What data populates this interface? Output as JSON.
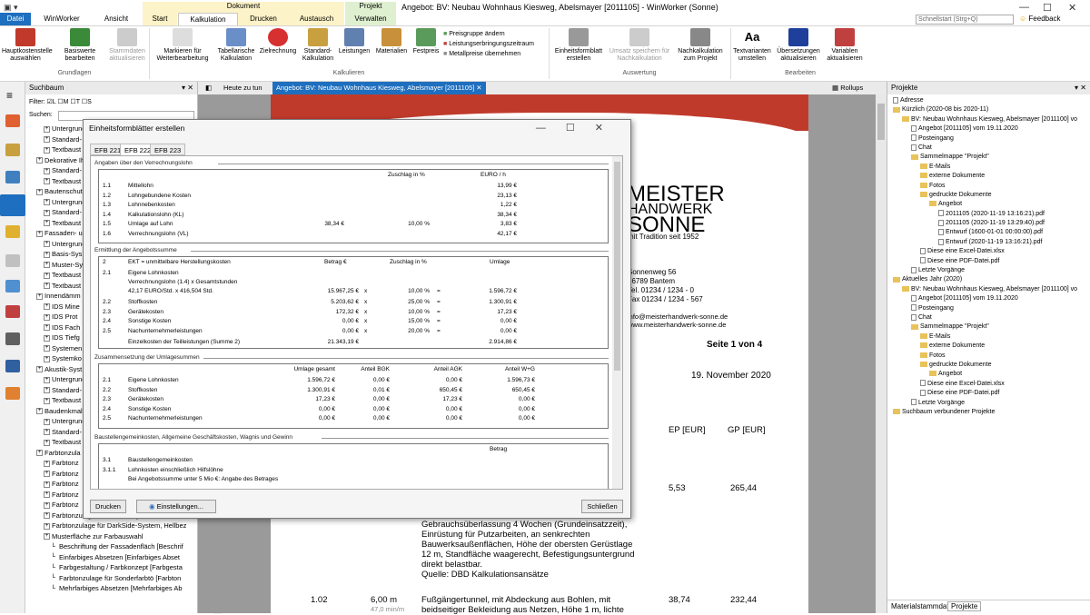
{
  "window": {
    "title": "Angebot: BV: Neubau Wohnhaus Kiesweg, Abelsmayer [2011105] - WinWorker (Sonne)",
    "context_group_dokument": "Dokument",
    "context_group_projekt": "Projekt",
    "search_placeholder": "Schnellstart (Strg+Q)",
    "feedback": "Feedback",
    "minimize": "—",
    "maximize": "☐",
    "close": "✕"
  },
  "tabs": [
    "Datei",
    "WinWorker",
    "Ansicht",
    "Start",
    "Kalkulation",
    "Drucken",
    "Austausch",
    "Verwalten"
  ],
  "ribbon": {
    "buttons": [
      {
        "label": "Hauptkostenstelle auswählen",
        "color": "#c0392b"
      },
      {
        "label": "Basiswerte bearbeiten",
        "color": "#3a8a3a"
      },
      {
        "label": "Stammdaten aktualisieren",
        "color": "#aaaaaa"
      },
      {
        "label": "Markieren für Weiterbearbeitung",
        "color": "#bbbbbb"
      },
      {
        "label": "Tabellarische Kalkulation",
        "color": "#6a8fc8"
      },
      {
        "label": "Zielrechnung",
        "color": "#d63030"
      },
      {
        "label": "Standard-Kalkulation",
        "color": "#c8a040"
      },
      {
        "label": "Leistungen",
        "color": "#6080b0"
      },
      {
        "label": "Materialien",
        "color": "#c8903a"
      },
      {
        "label": "Festpreis",
        "color": "#5a9a5a"
      },
      {
        "label": "Einheitsformblatt erstellen",
        "color": "#666666"
      },
      {
        "label": "Umsatz speichern für Nachkalkulation",
        "color": "#aaaaaa"
      },
      {
        "label": "Nachkalkulation zum Projekt",
        "color": "#777777"
      },
      {
        "label": "Textvarianten umstellen",
        "color": "#333333"
      },
      {
        "label": "Übersetzungen aktualisieren",
        "color": "#1e3f9a"
      },
      {
        "label": "Variablen aktualisieren",
        "color": "#c04040"
      }
    ],
    "small": [
      "Preisgruppe ändern",
      "Leistungserbringungszeitraum",
      "Metallpreise übernehmen"
    ],
    "groups": [
      "Grundlagen",
      "Kalkulieren",
      "Auswertung",
      "Bearbeiten"
    ]
  },
  "suchbaum": {
    "title": "Suchbaum",
    "filter_label": "Filter:",
    "filters": [
      "L",
      "M",
      "T",
      "S"
    ],
    "search_label": "Suchen:",
    "items": [
      {
        "t": "Untergrund",
        "d": 2
      },
      {
        "t": "Standard-",
        "d": 2
      },
      {
        "t": "Textbaust",
        "d": 2
      },
      {
        "t": "Dekorative Ih",
        "d": 1
      },
      {
        "t": "Standard-",
        "d": 2
      },
      {
        "t": "Textbaust",
        "d": 2
      },
      {
        "t": "Bautenschutz",
        "d": 1
      },
      {
        "t": "Untergrund",
        "d": 2
      },
      {
        "t": "Standard-",
        "d": 2
      },
      {
        "t": "Textbaust",
        "d": 2
      },
      {
        "t": "Fassaden- u",
        "d": 1
      },
      {
        "t": "Untergrund",
        "d": 2
      },
      {
        "t": "Basis-Sys",
        "d": 2
      },
      {
        "t": "Muster-Sy",
        "d": 2
      },
      {
        "t": "Textbaust",
        "d": 2
      },
      {
        "t": "Textbaust",
        "d": 2
      },
      {
        "t": "Innendämm",
        "d": 1
      },
      {
        "t": "IDS Mine",
        "d": 2
      },
      {
        "t": "IDS Prot",
        "d": 2
      },
      {
        "t": "IDS Fach",
        "d": 2
      },
      {
        "t": "IDS Tiefg",
        "d": 2
      },
      {
        "t": "Systemen",
        "d": 2
      },
      {
        "t": "Systemko",
        "d": 2
      },
      {
        "t": "Akustik-Syst",
        "d": 1
      },
      {
        "t": "Untergrund",
        "d": 2
      },
      {
        "t": "Standard-",
        "d": 2
      },
      {
        "t": "Textbaust",
        "d": 2
      },
      {
        "t": "Baudenkmal",
        "d": 1
      },
      {
        "t": "Untergrund",
        "d": 2
      },
      {
        "t": "Standard-",
        "d": 2
      },
      {
        "t": "Textbaust",
        "d": 2
      },
      {
        "t": "Farbtonzula",
        "d": 1
      },
      {
        "t": "Farbtonz",
        "d": 2
      },
      {
        "t": "Farbtonz",
        "d": 2
      },
      {
        "t": "Farbtonz",
        "d": 2
      },
      {
        "t": "Farbtonz",
        "d": 2
      },
      {
        "t": "Farbtonz",
        "d": 2
      },
      {
        "t": "Farbtonzulage für Carbon-System, Hellbez",
        "d": 2
      },
      {
        "t": "Farbtonzulage für DarkSide-System, Hellbez",
        "d": 2
      },
      {
        "t": "Musterfläche zur Farbauswahl",
        "d": 2
      },
      {
        "t": "Beschriftung der Fassadenfläch [Beschrif",
        "d": 3
      },
      {
        "t": "Einfarbiges Absetzen [Einfarbiges Abset",
        "d": 3
      },
      {
        "t": "Farbgestaltung / Farbkonzept [Farbgesta",
        "d": 3
      },
      {
        "t": "Farbtonzulage für Sonderfarbtö [Farbton",
        "d": 3
      },
      {
        "t": "Mehrfarbiges Absetzen [Mehrfarbiges Ab",
        "d": 3
      }
    ]
  },
  "doctabs": [
    "Heute zu tun",
    "Angebot: BV: Neubau Wohnhaus Kiesweg, Abelsmayer [2011105]"
  ],
  "rollups": "Rollups",
  "document": {
    "company1": "MEISTER",
    "company2": "HANDWERK",
    "company3": "SONNE",
    "tagline": "mit Tradition seit 1952",
    "addr": [
      "Sonnenweg 56",
      "56789 Bantem",
      "Tel. 01234 / 1234 - 0",
      "Fax 01234 / 1234 - 567"
    ],
    "web": [
      "info@meisterhandwerk-sonne.de",
      "www.meisterhandwerk-sonne.de"
    ],
    "page": "Seite 1 von 4",
    "date": "19. November 2020",
    "col_ep": "EP [EUR]",
    "col_gp": "GP [EUR]",
    "row1_ep": "5,53",
    "row1_gp": "265,44",
    "text1": [
      "Gebrauchsüberlassung 4 Wochen (Grundeinsatzzeit),",
      "Einrüstung für Putzarbeiten, an senkrechten",
      "Bauwerksaußenflächen, Höhe der obersten Gerüstlage",
      "12 m, Standfläche waagerecht, Befestigungsuntergrund",
      "direkt belastbar.",
      "Quelle: DBD Kalkulationsansätze"
    ],
    "row2_pos": "1.02",
    "row2_qty": "6,00 m",
    "row2_sub": "47,0 min/m",
    "row2_ep": "38,74",
    "row2_gp": "232,44",
    "text2": [
      "Fußgängertunnel, mit Abdeckung aus Bohlen, mit",
      "beidseitiger Bekleidung aus Netzen, Höhe 1 m, lichte"
    ]
  },
  "projekte": {
    "title": "Projekte",
    "items": [
      {
        "t": "Adresse",
        "d": 0,
        "k": "doc"
      },
      {
        "t": "Kürzlich (2020-08 bis 2020-11)",
        "d": 0,
        "k": "fold"
      },
      {
        "t": "BV: Neubau Wohnhaus Kiesweg, Abelsmayer [2011100] vo",
        "d": 1,
        "k": "fold"
      },
      {
        "t": "Angebot [2011105] vom 19.11.2020",
        "d": 2,
        "k": "doc"
      },
      {
        "t": "Posteingang",
        "d": 2,
        "k": "doc"
      },
      {
        "t": "Chat",
        "d": 2,
        "k": "doc"
      },
      {
        "t": "Sammelmappe \"Projekt\"",
        "d": 2,
        "k": "fold"
      },
      {
        "t": "E-Mails",
        "d": 3,
        "k": "fold"
      },
      {
        "t": "externe Dokumente",
        "d": 3,
        "k": "fold"
      },
      {
        "t": "Fotos",
        "d": 3,
        "k": "fold"
      },
      {
        "t": "gedruckte Dokumente",
        "d": 3,
        "k": "fold"
      },
      {
        "t": "Angebot",
        "d": 4,
        "k": "fold"
      },
      {
        "t": "2011105 (2020-11-19 13:16:21).pdf",
        "d": 5,
        "k": "doc"
      },
      {
        "t": "2011105 (2020-11-19 13:29:40).pdf",
        "d": 5,
        "k": "doc"
      },
      {
        "t": "Entwurf (1600-01-01 00:00:00).pdf",
        "d": 5,
        "k": "doc"
      },
      {
        "t": "Entwurf (2020-11-19 13:16:21).pdf",
        "d": 5,
        "k": "doc"
      },
      {
        "t": "Diese eine Excel-Datei.xlsx",
        "d": 3,
        "k": "doc"
      },
      {
        "t": "Diese eine PDF-Datei.pdf",
        "d": 3,
        "k": "doc"
      },
      {
        "t": "Letzte Vorgänge",
        "d": 2,
        "k": "doc"
      },
      {
        "t": "Aktuelles Jahr (2020)",
        "d": 0,
        "k": "fold"
      },
      {
        "t": "BV: Neubau Wohnhaus Kiesweg, Abelsmayer [2011100] vo",
        "d": 1,
        "k": "fold"
      },
      {
        "t": "Angebot [2011105] vom 19.11.2020",
        "d": 2,
        "k": "doc"
      },
      {
        "t": "Posteingang",
        "d": 2,
        "k": "doc"
      },
      {
        "t": "Chat",
        "d": 2,
        "k": "doc"
      },
      {
        "t": "Sammelmappe \"Projekt\"",
        "d": 2,
        "k": "fold"
      },
      {
        "t": "E-Mails",
        "d": 3,
        "k": "fold"
      },
      {
        "t": "externe Dokumente",
        "d": 3,
        "k": "fold"
      },
      {
        "t": "Fotos",
        "d": 3,
        "k": "fold"
      },
      {
        "t": "gedruckte Dokumente",
        "d": 3,
        "k": "fold"
      },
      {
        "t": "Angebot",
        "d": 4,
        "k": "fold"
      },
      {
        "t": "Diese eine Excel-Datei.xlsx",
        "d": 3,
        "k": "doc"
      },
      {
        "t": "Diese eine PDF-Datei.pdf",
        "d": 3,
        "k": "doc"
      },
      {
        "t": "Letzte Vorgänge",
        "d": 2,
        "k": "doc"
      },
      {
        "t": "Suchbaum verbundener Projekte",
        "d": 0,
        "k": "fold"
      }
    ],
    "footer_tabs": [
      "Materialstammdaten",
      "Projekte"
    ]
  },
  "dialog": {
    "title": "Einheitsformblätter erstellen",
    "tabs": [
      "EFB 221",
      "EFB 222",
      "EFB 223"
    ],
    "s1": {
      "title": "Angaben über den Verrechnungslohn",
      "h_zuschlag": "Zuschlag in %",
      "h_euro": "EURO / h",
      "rows": [
        [
          "1.1",
          "Mittellohn",
          "",
          "",
          "13,99 €"
        ],
        [
          "1.2",
          "Lohngebundene Kosten",
          "",
          "",
          "23,13 €"
        ],
        [
          "1.3",
          "Lohnnebenkosten",
          "",
          "",
          "1,22 €"
        ],
        [
          "1.4",
          "Kalkulationslohn (KL)",
          "",
          "",
          "38,34 €"
        ],
        [
          "1.5",
          "Umlage auf Lohn",
          "38,34 €",
          "10,00 %",
          "3,83 €"
        ],
        [
          "1.6",
          "Verrechnungslohn (VL)",
          "",
          "",
          "42,17 €"
        ]
      ]
    },
    "s2": {
      "title": "Ermittlung der Angebotssumme",
      "h_num": "2",
      "h_ekt": "EKT = unmittelbare Herstellungskosten",
      "h_betrag": "Betrag €",
      "h_zuschlag": "Zuschlag in %",
      "h_umlage": "Umlage",
      "r21": "2.1",
      "r21a": "Eigene Lohnkosten",
      "r21b": "Verrechnungslohn (1.4) x Gesamtstunden",
      "r21c": "42,17 EURO/Std. x 416,504 Std.",
      "r21d": "15.967,25 €",
      "r21e": "10,00 %",
      "r21f": "1.596,72 €",
      "rows": [
        [
          "2.2",
          "Stoffkosten",
          "5.203,62 €",
          "25,00 %",
          "1.300,91 €"
        ],
        [
          "2.3",
          "Gerätekosten",
          "172,32 €",
          "10,00 %",
          "17,23 €"
        ],
        [
          "2.4",
          "Sonstige Kosten",
          "0,00 €",
          "15,00 %",
          "0,00 €"
        ],
        [
          "2.5",
          "Nachunternehmerleistungen",
          "0,00 €",
          "20,00 %",
          "0,00 €"
        ]
      ],
      "sum_label": "Einzelkosten der Teilleistungen (Summe 2)",
      "sum_betrag": "21.343,19 €",
      "sum_umlage": "2.914,86 €",
      "x": "x",
      "eq": "="
    },
    "s3": {
      "title": "Zusammensetzung der Umlagesummen",
      "h": [
        "Umlage gesamt",
        "Anteil BGK",
        "Anteil AGK",
        "Anteil W+G"
      ],
      "rows": [
        [
          "2.1",
          "Eigene Lohnkosten",
          "1.596,72 €",
          "0,00 €",
          "0,00 €",
          "1.596,73 €"
        ],
        [
          "2.2",
          "Stoffkosten",
          "1.300,91 €",
          "0,01 €",
          "650,45 €",
          "650,45 €"
        ],
        [
          "2.3",
          "Gerätekosten",
          "17,23 €",
          "0,00 €",
          "17,23 €",
          "0,00 €"
        ],
        [
          "2.4",
          "Sonstige Kosten",
          "0,00 €",
          "0,00 €",
          "0,00 €",
          "0,00 €"
        ],
        [
          "2.5",
          "Nachunternehmerleistungen",
          "0,00 €",
          "0,00 €",
          "0,00 €",
          "0,00 €"
        ]
      ]
    },
    "s4": {
      "title": "Baustellengemeinkosten, Allgemeine Geschäftskosten, Wagnis und Gewinn",
      "h_betrag": "Betrag",
      "rows": [
        [
          "3.1",
          "Baustellengemeinkosten"
        ],
        [
          "3.1.1",
          "Lohnkosten einschließlich Hilfslöhne"
        ],
        [
          "",
          "Bei Angebotssumme unter 5 Mio €: Angabe des Betrages"
        ]
      ]
    },
    "btn_print": "Drucken",
    "btn_settings": "Einstellungen...",
    "btn_close": "Schließen"
  }
}
